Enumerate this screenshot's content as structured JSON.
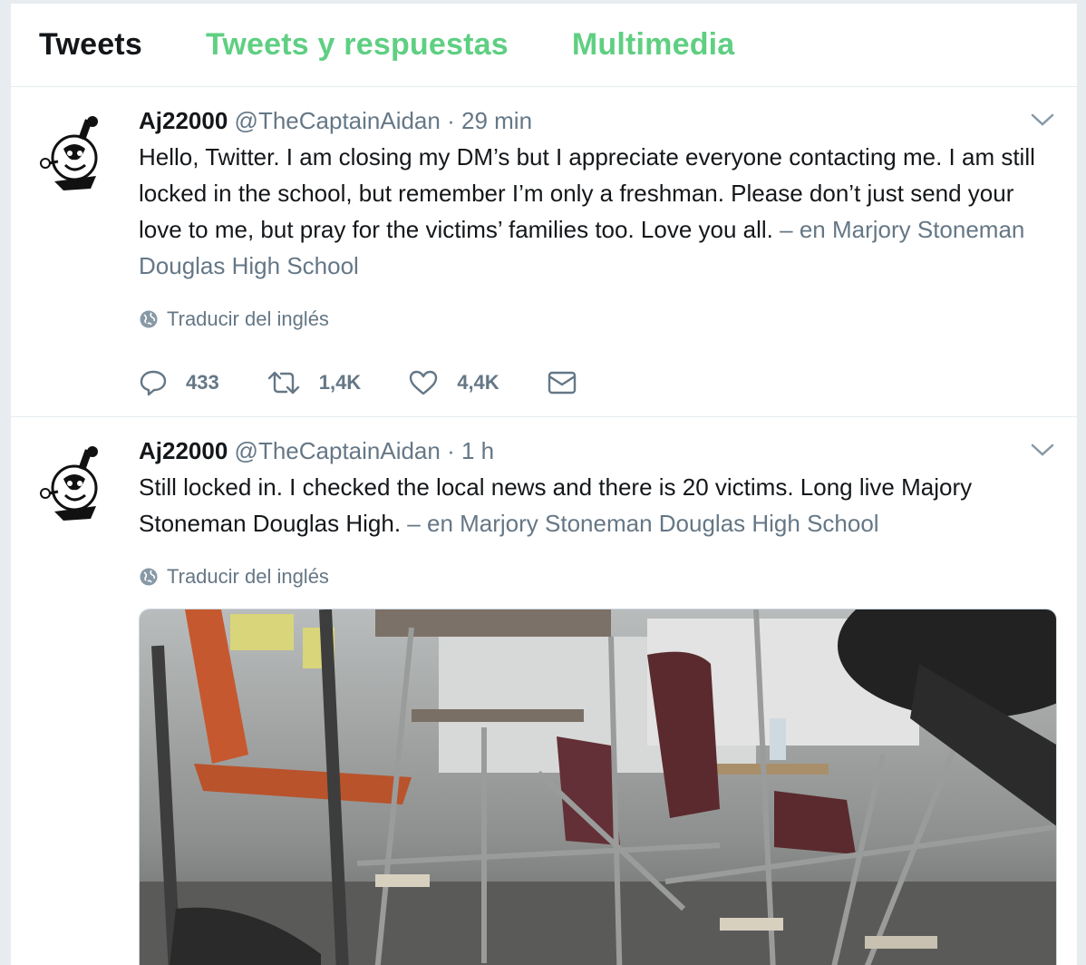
{
  "tabs": [
    "Tweets",
    "Tweets y respuestas",
    "Multimedia"
  ],
  "tweets": [
    {
      "name": "Aj22000",
      "handle": "@TheCaptainAidan",
      "separator": "·",
      "time": "29 min",
      "text": "Hello, Twitter. I am closing my DM’s but I appreciate everyone contacting me. I am still locked in the school, but remember I’m only a freshman. Please don’t just send your love to me, but pray for the victims’ families too. Love you all.",
      "location": "– en Marjory Stoneman Douglas High School",
      "translate": "Traducir del inglés",
      "replies": "433",
      "retweets": "1,4K",
      "likes": "4,4K"
    },
    {
      "name": "Aj22000",
      "handle": "@TheCaptainAidan",
      "separator": "·",
      "time": "1 h",
      "text": "Still locked in. I checked the local news and there is 20 victims. Long live Majory Stoneman Douglas High.",
      "location": "– en Marjory Stoneman Douglas High School",
      "translate": "Traducir del inglés"
    }
  ],
  "colors": {
    "accent_green": "#5fcf82",
    "muted": "#657786",
    "text": "#14171a"
  },
  "icons": [
    "reply-icon",
    "retweet-icon",
    "like-icon",
    "dm-icon",
    "globe-icon",
    "chevron-down-icon"
  ]
}
